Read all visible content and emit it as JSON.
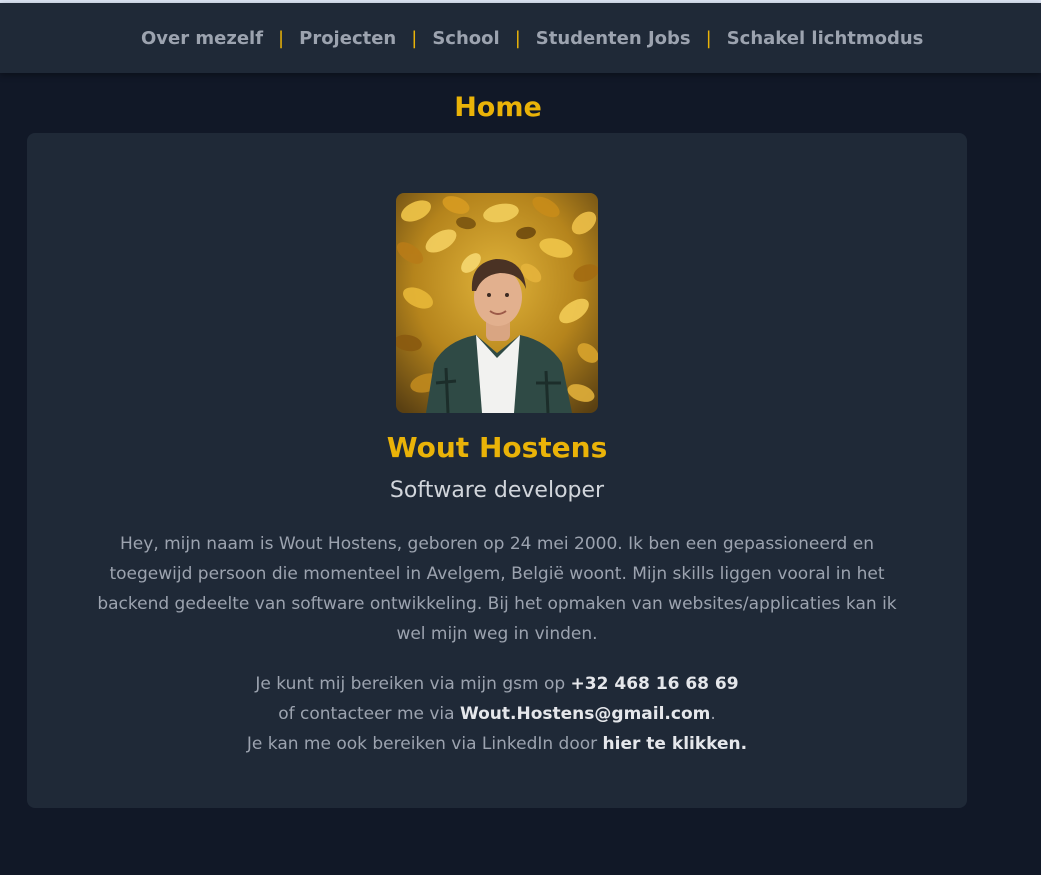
{
  "nav": {
    "items": [
      {
        "label": "Over mezelf"
      },
      {
        "label": "Projecten"
      },
      {
        "label": "School"
      },
      {
        "label": "Studenten Jobs"
      },
      {
        "label": "Schakel lichtmodus"
      }
    ],
    "separator": "|"
  },
  "page": {
    "title": "Home"
  },
  "profile": {
    "name": "Wout Hostens",
    "role": "Software developer",
    "bio": "Hey, mijn naam is Wout Hostens, geboren op 24 mei 2000. Ik ben een gepassioneerd en toegewijd persoon die momenteel in Avelgem, België woont. Mijn skills liggen vooral in het backend gedeelte van software ontwikkeling. Bij het opmaken van websites/applicaties kan ik wel mijn weg in vinden."
  },
  "contact": {
    "phone_prefix": "Je kunt mij bereiken via mijn gsm op ",
    "phone": "+32 468 16 68 69",
    "email_prefix": "of contacteer me via ",
    "email": "Wout.Hostens@gmail.com",
    "email_suffix": ".",
    "linkedin_prefix": "Je kan me ook bereiken via LinkedIn door ",
    "linkedin_link": "hier te klikken."
  },
  "colors": {
    "background": "#111827",
    "card": "#1f2937",
    "accent": "#eab308",
    "text_muted": "#9ca3af"
  }
}
